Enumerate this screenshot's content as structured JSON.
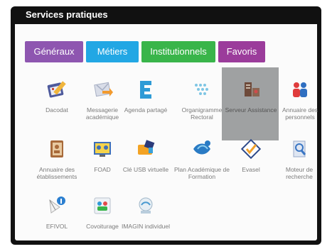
{
  "panel": {
    "title": "Services pratiques"
  },
  "tabs": [
    {
      "label": "Généraux",
      "color": "#8e56b0"
    },
    {
      "label": "Métiers",
      "color": "#22a7e4"
    },
    {
      "label": "Institutionnels",
      "color": "#39b54a"
    },
    {
      "label": "Favoris",
      "color": "#9b3c9b"
    }
  ],
  "selection_color": "#9fa1a2",
  "items": [
    {
      "label": "Dacodat",
      "icon": "calendar-pencil-icon"
    },
    {
      "label": "Messagerie académique",
      "icon": "mail-arrow-icon"
    },
    {
      "label": "Agenda partagé",
      "icon": "agenda-bracket-icon"
    },
    {
      "label": "Organigramme Rectoral",
      "icon": "organigram-icon"
    },
    {
      "label": "Serveur Assistance",
      "icon": "server-assistance-icon",
      "selected": true
    },
    {
      "label": "Annuaire des personnels",
      "icon": "people-directory-icon"
    },
    {
      "label": "Annuaire des établissements",
      "icon": "address-book-icon"
    },
    {
      "label": "FOAD",
      "icon": "foad-icon"
    },
    {
      "label": "Clé USB virtuelle",
      "icon": "usb-key-icon"
    },
    {
      "label": "Plan Académique de Formation",
      "icon": "training-plan-icon"
    },
    {
      "label": "Evasel",
      "icon": "checkbox-icon"
    },
    {
      "label": "Moteur de recherche",
      "icon": "search-engine-icon"
    },
    {
      "label": "EFIVOL",
      "icon": "efivol-icon"
    },
    {
      "label": "Covoiturage",
      "icon": "carpool-icon"
    },
    {
      "label": "IMAGIN individuel",
      "icon": "imagin-icon"
    }
  ]
}
